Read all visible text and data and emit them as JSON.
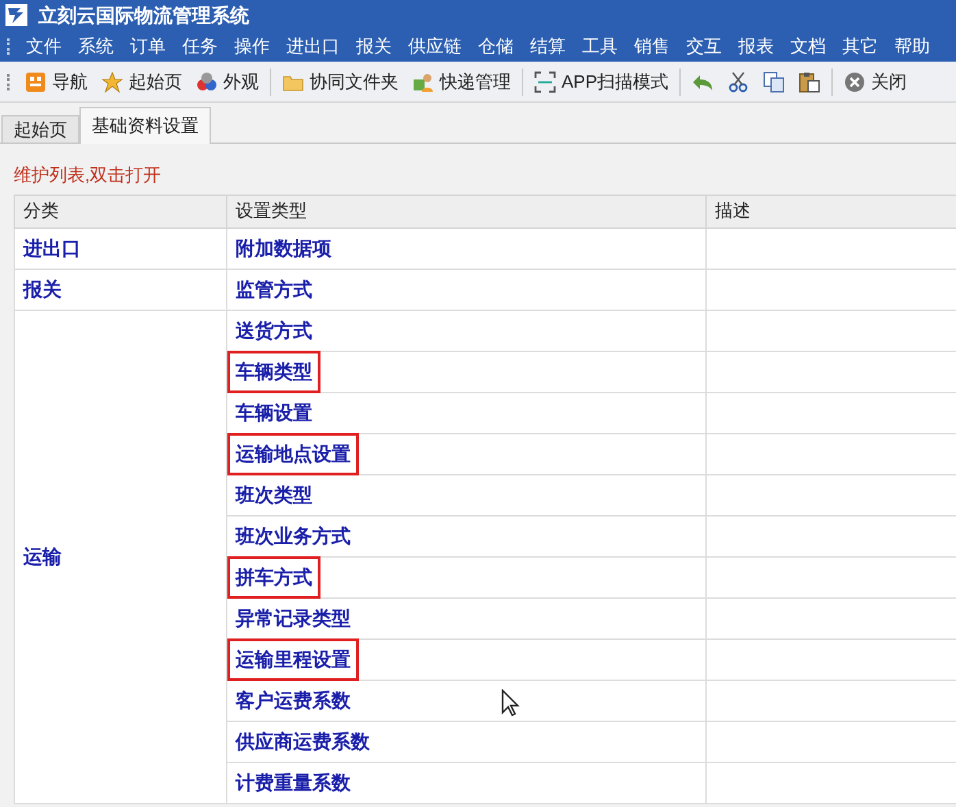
{
  "window": {
    "title": "立刻云国际物流管理系统"
  },
  "menu": [
    "文件",
    "系统",
    "订单",
    "任务",
    "操作",
    "进出口",
    "报关",
    "供应链",
    "仓储",
    "结算",
    "工具",
    "销售",
    "交互",
    "报表",
    "文档",
    "其它",
    "帮助"
  ],
  "toolbar": [
    [
      {
        "kind": "labeled",
        "label": "导航"
      },
      {
        "kind": "labeled",
        "label": "起始页"
      },
      {
        "kind": "labeled",
        "label": "外观"
      }
    ],
    [
      {
        "kind": "labeled",
        "label": "协同文件夹"
      },
      {
        "kind": "labeled",
        "label": "快递管理"
      }
    ],
    [
      {
        "kind": "labeled",
        "label": "APP扫描模式"
      }
    ],
    [
      {
        "kind": "icon"
      },
      {
        "kind": "icon"
      },
      {
        "kind": "icon"
      },
      {
        "kind": "icon"
      }
    ],
    [
      {
        "kind": "labeled",
        "label": "关闭"
      }
    ]
  ],
  "tabs": [
    {
      "label": "起始页",
      "selected": false
    },
    {
      "label": "基础资料设置",
      "selected": true
    }
  ],
  "hint": "维护列表,双击打开",
  "table": {
    "columns": [
      "分类",
      "设置类型",
      "描述"
    ],
    "groups": [
      {
        "category": "进出口",
        "items": [
          {
            "name": "附加数据项",
            "highlighted": false
          }
        ]
      },
      {
        "category": "报关",
        "items": [
          {
            "name": "监管方式",
            "highlighted": false
          }
        ]
      },
      {
        "category": "运输",
        "items": [
          {
            "name": "送货方式",
            "highlighted": false
          },
          {
            "name": "车辆类型",
            "highlighted": true
          },
          {
            "name": "车辆设置",
            "highlighted": false
          },
          {
            "name": "运输地点设置",
            "highlighted": true
          },
          {
            "name": "班次类型",
            "highlighted": false
          },
          {
            "name": "班次业务方式",
            "highlighted": false
          },
          {
            "name": "拼车方式",
            "highlighted": true
          },
          {
            "name": "异常记录类型",
            "highlighted": false
          },
          {
            "name": "运输里程设置",
            "highlighted": true
          },
          {
            "name": "客户运费系数",
            "highlighted": false
          },
          {
            "name": "供应商运费系数",
            "highlighted": false
          },
          {
            "name": "计费重量系数",
            "highlighted": false
          }
        ]
      }
    ]
  }
}
